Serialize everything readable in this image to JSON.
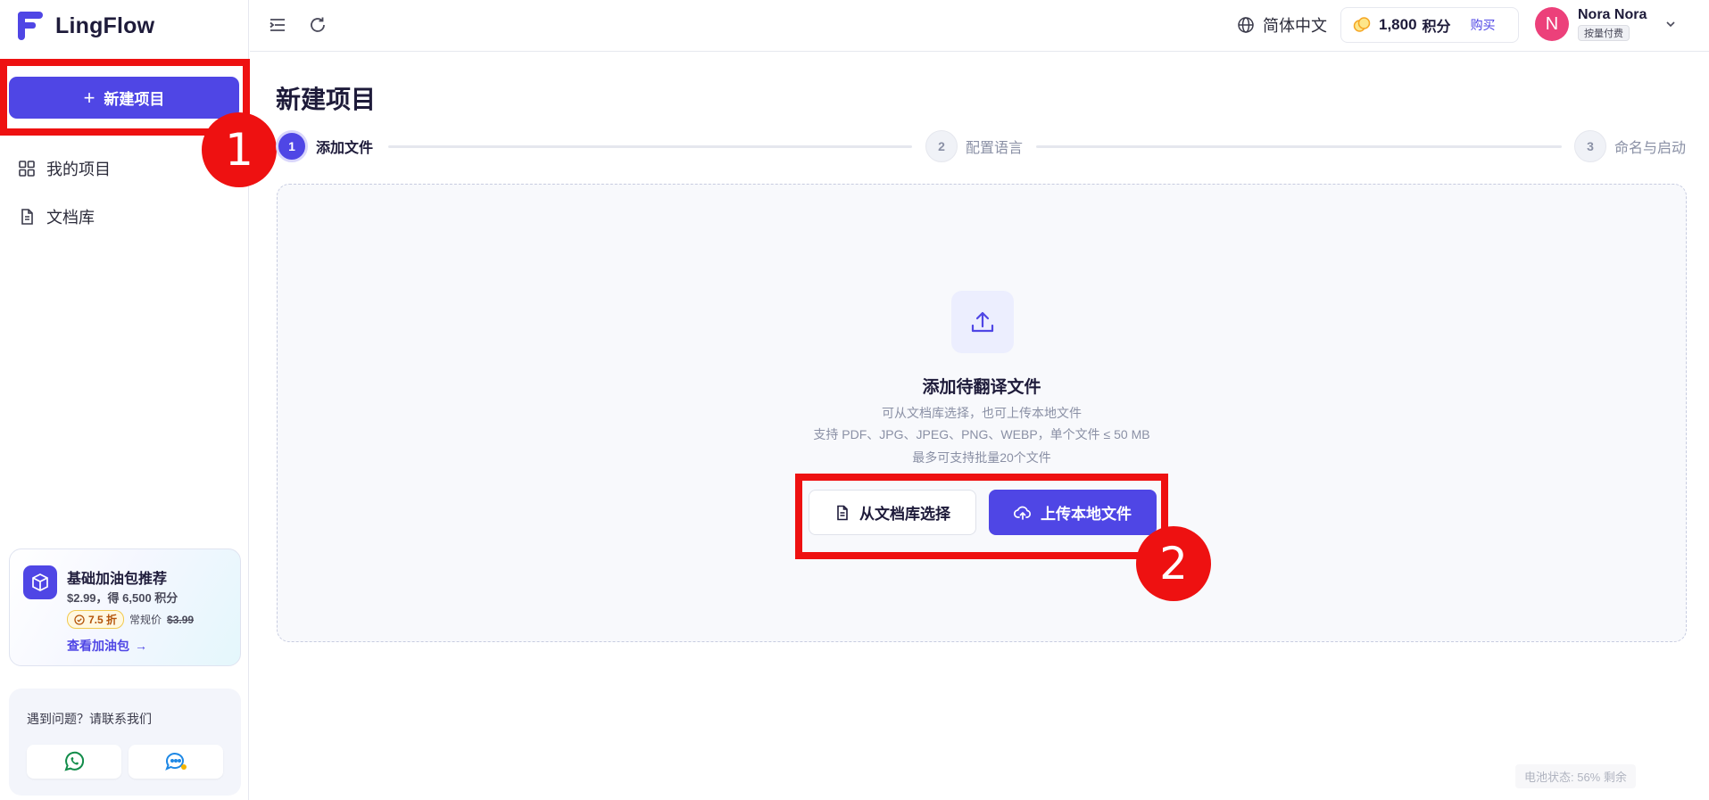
{
  "app": {
    "name": "LingFlow",
    "accent": "#4f46e5",
    "highlight": "#ee1111"
  },
  "sidebar": {
    "new_project_label": "新建项目",
    "items": [
      {
        "label": "我的项目",
        "icon": "grid-icon"
      },
      {
        "label": "文档库",
        "icon": "document-icon"
      }
    ],
    "promo": {
      "title": "基础加油包推荐",
      "price_line": "$2.99，得 6,500 积分",
      "discount": "7.5 折",
      "regular_label": "常规价",
      "regular_price": "$3.99",
      "link": "查看加油包"
    },
    "support": {
      "text": "遇到问题？请联系我们"
    }
  },
  "topbar": {
    "language": "简体中文",
    "credits_value": "1,800",
    "credits_unit": "积分",
    "buy_label": "购买",
    "user": {
      "initial": "N",
      "name": "Nora Nora",
      "plan": "按量付费",
      "avatar_color": "#ec407a"
    }
  },
  "main": {
    "title": "新建项目",
    "steps": [
      {
        "num": "1",
        "label": "添加文件",
        "active": true
      },
      {
        "num": "2",
        "label": "配置语言",
        "active": false
      },
      {
        "num": "3",
        "label": "命名与启动",
        "active": false
      }
    ],
    "dropzone": {
      "title": "添加待翻译文件",
      "line1": "可从文档库选择，也可上传本地文件",
      "line2": "支持 PDF、JPG、JPEG、PNG、WEBP，单个文件 ≤ 50 MB",
      "line3": "最多可支持批量20个文件",
      "library_button": "从文档库选择",
      "upload_button": "上传本地文件"
    }
  },
  "annotations": {
    "badge1": "1",
    "badge2": "2"
  },
  "status": {
    "battery": "电池状态: 56% 剩余"
  }
}
